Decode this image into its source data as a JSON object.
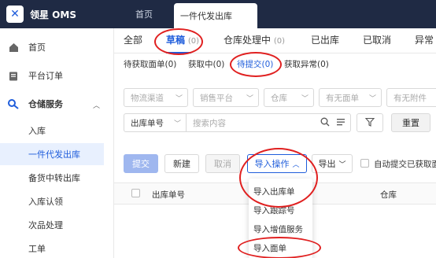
{
  "app": {
    "logo_letter": "✕",
    "name": "领星 OMS"
  },
  "top_tabs": [
    {
      "label": "首页"
    },
    {
      "label": "一件代发出库"
    }
  ],
  "sidebar": {
    "items": [
      {
        "label": "首页",
        "icon": "home-icon"
      },
      {
        "label": "平台订单",
        "icon": "clipboard-icon"
      },
      {
        "label": "仓储服务",
        "icon": "warehouse-icon"
      },
      {
        "label": "入库"
      },
      {
        "label": "一件代发出库"
      },
      {
        "label": "备货中转出库"
      },
      {
        "label": "入库认领"
      },
      {
        "label": "次品处理"
      },
      {
        "label": "工单"
      }
    ]
  },
  "status_tabs": [
    {
      "label": "全部",
      "count": ""
    },
    {
      "label": "草稿",
      "count": "(0)"
    },
    {
      "label": "仓库处理中",
      "count": "(0)"
    },
    {
      "label": "已出库",
      "count": ""
    },
    {
      "label": "已取消",
      "count": ""
    },
    {
      "label": "异常",
      "count": ""
    }
  ],
  "sub_tabs": [
    {
      "label": "待获取面单",
      "count": "(0)"
    },
    {
      "label": "获取中",
      "count": "(0)"
    },
    {
      "label": "待提交",
      "count": "(0)"
    },
    {
      "label": "获取异常",
      "count": "(0)"
    }
  ],
  "filters": {
    "channel": "物流渠道",
    "platform": "销售平台",
    "warehouse": "仓库",
    "has_label": "有无面单",
    "has_attachment": "有无附件",
    "search_field": "出库单号",
    "search_placeholder": "搜索内容",
    "reset": "重置"
  },
  "actions": {
    "submit": "提交",
    "new": "新建",
    "cancel": "取消",
    "import": "导入操作",
    "export": "导出",
    "auto_submit": "自动提交已获取面"
  },
  "table": {
    "col_order_no": "出库单号",
    "col_warehouse": "仓库"
  },
  "import_menu": [
    {
      "label": "导入出库单"
    },
    {
      "label": "导入跟踪号"
    },
    {
      "label": "导入增值服务"
    },
    {
      "label": "导入面单"
    }
  ],
  "colors": {
    "accent": "#1f5ddb",
    "annotation": "#e02020",
    "topbar": "#1f2a44"
  }
}
